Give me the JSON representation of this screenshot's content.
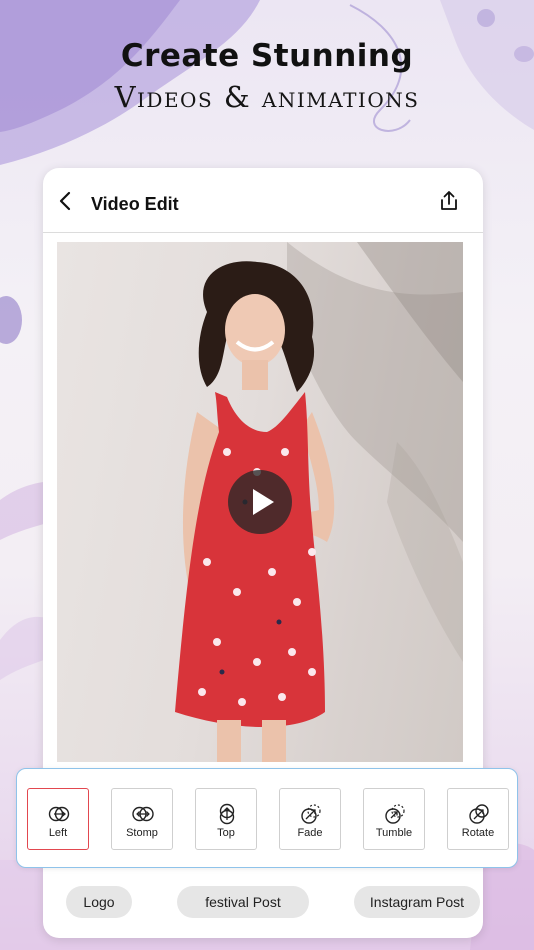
{
  "promo": {
    "headline": "Create Stunning",
    "subline": "Videos & animations"
  },
  "appbar": {
    "title": "Video Edit",
    "back_icon": "chevron-left-icon",
    "share_icon": "share-icon"
  },
  "preview": {
    "play_icon": "play-icon"
  },
  "animations": {
    "selected": "Left",
    "items": [
      {
        "label": "Left",
        "icon": "slide-left-icon"
      },
      {
        "label": "Stomp",
        "icon": "stomp-icon"
      },
      {
        "label": "Top",
        "icon": "slide-top-icon"
      },
      {
        "label": "Fade",
        "icon": "fade-icon"
      },
      {
        "label": "Tumble",
        "icon": "tumble-icon"
      },
      {
        "label": "Rotate",
        "icon": "rotate-icon"
      }
    ]
  },
  "templates": {
    "chips": [
      "Logo",
      "festival Post",
      "Instagram Post"
    ]
  },
  "colors": {
    "selected_border": "#e2474f",
    "panel_border": "#8fc3ea",
    "dress_red": "#d8343a"
  }
}
